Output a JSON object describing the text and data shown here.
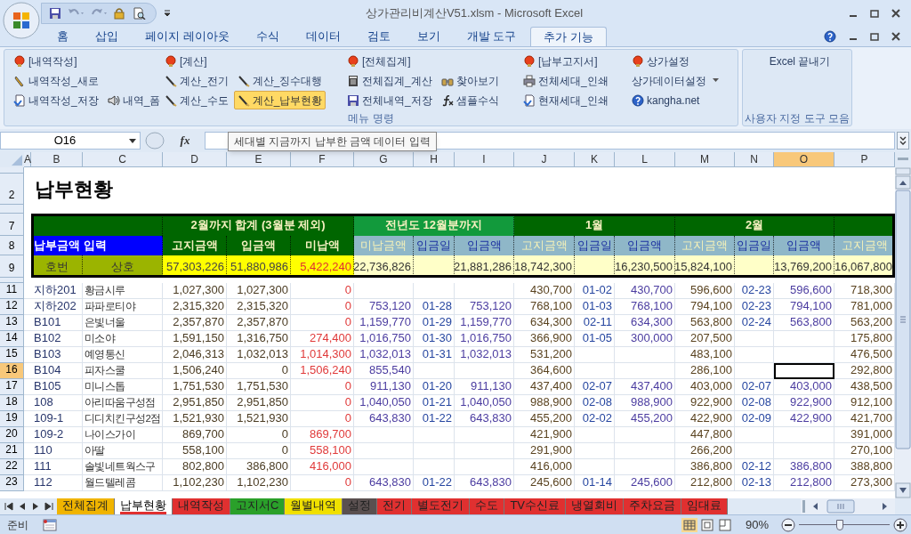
{
  "title_bar": {
    "title": "상가관리비계산V51.xlsm - Microsoft Excel"
  },
  "ribbon_tabs": [
    {
      "label": "홈",
      "selected": false
    },
    {
      "label": "삽입",
      "selected": false
    },
    {
      "label": "페이지 레이아웃",
      "selected": false
    },
    {
      "label": "수식",
      "selected": false
    },
    {
      "label": "데이터",
      "selected": false
    },
    {
      "label": "검토",
      "selected": false
    },
    {
      "label": "보기",
      "selected": false
    },
    {
      "label": "개발 도구",
      "selected": false
    },
    {
      "label": "추가 기능",
      "selected": true
    }
  ],
  "ribbon_groups": [
    {
      "label": "메뉴 명령",
      "columns": [
        [
          [
            {
              "label": "[내역작성]",
              "kind": "button",
              "selected": false
            }
          ],
          [
            {
              "label": "내역작성_새로",
              "kind": "button",
              "selected": false
            }
          ],
          [
            {
              "label": "내역작성_저장",
              "kind": "button",
              "selected": false
            },
            {
              "label": "내역_폼",
              "kind": "button",
              "selected": false
            }
          ]
        ],
        [
          [
            {
              "label": "[계산]",
              "kind": "button",
              "selected": false
            }
          ],
          [
            {
              "label": "계산_전기",
              "kind": "button",
              "selected": false
            },
            {
              "label": "계산_징수대행",
              "kind": "button",
              "selected": false
            }
          ],
          [
            {
              "label": "계산_수도",
              "kind": "button",
              "selected": false
            },
            {
              "label": "계산_납부현황",
              "kind": "button",
              "selected": true
            }
          ]
        ],
        [
          [
            {
              "label": "[전체집계]",
              "kind": "button",
              "selected": false
            }
          ],
          [
            {
              "label": "전체집계_계산",
              "kind": "button",
              "selected": false
            },
            {
              "label": "찾아보기",
              "kind": "button",
              "selected": false
            }
          ],
          [
            {
              "label": "전체내역_저장",
              "kind": "button",
              "selected": false
            },
            {
              "label": "샘플수식",
              "kind": "button",
              "selected": false
            }
          ]
        ],
        [
          [
            {
              "label": "[납부고지서]",
              "kind": "button",
              "selected": false
            }
          ],
          [
            {
              "label": "전체세대_인쇄",
              "kind": "button",
              "selected": false
            }
          ],
          [
            {
              "label": "현재세대_인쇄",
              "kind": "button",
              "selected": false
            }
          ]
        ],
        [
          [
            {
              "label": "상가설정",
              "kind": "button",
              "selected": false
            }
          ],
          [
            {
              "label": "상가데이터설정",
              "kind": "dropdown",
              "selected": false
            }
          ],
          [
            {
              "label": "kangha.net",
              "kind": "button",
              "selected": false
            }
          ]
        ]
      ]
    },
    {
      "label": "사용자 지정 도구 모음",
      "columns": [
        [
          [
            {
              "label": "Excel 끝내기",
              "kind": "button",
              "selected": false
            }
          ]
        ]
      ]
    }
  ],
  "formula_bar": {
    "name_box": "O16",
    "function_label": "fx",
    "tooltip": "세대별 지금까지 납부한 금액 데이터 입력"
  },
  "column_headers": [
    {
      "label": "A",
      "selected": false
    },
    {
      "label": "B",
      "selected": false
    },
    {
      "label": "C",
      "selected": false
    },
    {
      "label": "D",
      "selected": false
    },
    {
      "label": "E",
      "selected": false
    },
    {
      "label": "F",
      "selected": false
    },
    {
      "label": "G",
      "selected": false
    },
    {
      "label": "H",
      "selected": false
    },
    {
      "label": "I",
      "selected": false
    },
    {
      "label": "J",
      "selected": false
    },
    {
      "label": "K",
      "selected": false
    },
    {
      "label": "L",
      "selected": false
    },
    {
      "label": "M",
      "selected": false
    },
    {
      "label": "N",
      "selected": false
    },
    {
      "label": "O",
      "selected": true
    },
    {
      "label": "P",
      "selected": false
    }
  ],
  "sheet": {
    "title_row": {
      "row_label": "2",
      "text": "납부현황"
    },
    "header_rows": [
      {
        "row_label": "7",
        "cells": [
          {
            "kind": "group"
          },
          {
            "kind": "group",
            "text": "2월까지 합계 (3월분 제외)"
          },
          {
            "kind": "prior_group",
            "text": "전년도 12월분까지"
          },
          {
            "kind": "group",
            "text": "1월"
          },
          {
            "kind": "group",
            "text": "2월"
          },
          {
            "kind": "group"
          }
        ]
      },
      {
        "row_label": "8",
        "cells": [
          {
            "kind": "input_label",
            "text": "납부금액 입력"
          },
          {
            "kind": "total_head",
            "text": "고지금액"
          },
          {
            "kind": "total_head",
            "text": "입금액"
          },
          {
            "kind": "total_head",
            "text": "미납액"
          },
          {
            "kind": "bill_head",
            "text": "미납금액"
          },
          {
            "kind": "paid_head",
            "text": "입금일"
          },
          {
            "kind": "paid_head",
            "text": "입금액"
          },
          {
            "kind": "bill_head",
            "text": "고지금액"
          },
          {
            "kind": "paid_head",
            "text": "입금일"
          },
          {
            "kind": "paid_head",
            "text": "입금액"
          },
          {
            "kind": "bill_head",
            "text": "고지금액"
          },
          {
            "kind": "paid_head",
            "text": "입금일"
          },
          {
            "kind": "paid_head",
            "text": "입금액"
          },
          {
            "kind": "bill_head",
            "text": "고지금액"
          }
        ]
      },
      {
        "row_label": "9",
        "cells": [
          {
            "kind": "key_label",
            "text": "호번"
          },
          {
            "kind": "key_label",
            "text": "상호"
          },
          {
            "kind": "total",
            "text": "57,303,226"
          },
          {
            "kind": "total",
            "text": "51,880,986"
          },
          {
            "kind": "total_due",
            "text": "5,422,240"
          },
          {
            "kind": "month_total",
            "text": "22,736,826"
          },
          {
            "kind": "month_total"
          },
          {
            "kind": "month_total",
            "text": "21,881,286"
          },
          {
            "kind": "month_total",
            "text": "18,742,300"
          },
          {
            "kind": "month_total"
          },
          {
            "kind": "month_total",
            "text": "16,230,500"
          },
          {
            "kind": "month_total",
            "text": "15,824,100"
          },
          {
            "kind": "month_total"
          },
          {
            "kind": "month_total",
            "text": "13,769,200"
          },
          {
            "kind": "month_total",
            "text": "16,067,800"
          }
        ]
      }
    ],
    "data_rows": [
      {
        "row_label": "11",
        "selected": false,
        "cells": [
          "지하201",
          "황금시루",
          "1,027,300",
          "1,027,300",
          "0",
          null,
          null,
          null,
          "430,700",
          "01-02",
          "430,700",
          "596,600",
          "02-23",
          "596,600",
          "718,300"
        ]
      },
      {
        "row_label": "12",
        "selected": false,
        "cells": [
          "지하202",
          "파파로티야",
          "2,315,320",
          "2,315,320",
          "0",
          "753,120",
          "01-28",
          "753,120",
          "768,100",
          "01-03",
          "768,100",
          "794,100",
          "02-23",
          "794,100",
          "781,000"
        ]
      },
      {
        "row_label": "13",
        "selected": false,
        "cells": [
          "B101",
          "은빛너울",
          "2,357,870",
          "2,357,870",
          "0",
          "1,159,770",
          "01-29",
          "1,159,770",
          "634,300",
          "02-11",
          "634,300",
          "563,800",
          "02-24",
          "563,800",
          "563,200"
        ]
      },
      {
        "row_label": "14",
        "selected": false,
        "cells": [
          "B102",
          "미소야",
          "1,591,150",
          "1,316,750",
          "274,400",
          "1,016,750",
          "01-30",
          "1,016,750",
          "366,900",
          "01-05",
          "300,000",
          "207,500",
          null,
          null,
          "175,800"
        ]
      },
      {
        "row_label": "15",
        "selected": false,
        "cells": [
          "B103",
          "예영통신",
          "2,046,313",
          "1,032,013",
          "1,014,300",
          "1,032,013",
          "01-31",
          "1,032,013",
          "531,200",
          null,
          null,
          "483,100",
          null,
          null,
          "476,500"
        ]
      },
      {
        "row_label": "16",
        "selected": true,
        "cells": [
          "B104",
          "피자스쿨",
          "1,506,240",
          "0",
          "1,506,240",
          "855,540",
          null,
          null,
          "364,600",
          null,
          null,
          "286,100",
          null,
          null,
          "292,800"
        ]
      },
      {
        "row_label": "17",
        "selected": false,
        "cells": [
          "B105",
          "미니스톱",
          "1,751,530",
          "1,751,530",
          "0",
          "911,130",
          "01-20",
          "911,130",
          "437,400",
          "02-07",
          "437,400",
          "403,000",
          "02-07",
          "403,000",
          "438,500"
        ]
      },
      {
        "row_label": "18",
        "selected": false,
        "cells": [
          "108",
          "아리따움구성점",
          "2,951,850",
          "2,951,850",
          "0",
          "1,040,050",
          "01-21",
          "1,040,050",
          "988,900",
          "02-08",
          "988,900",
          "922,900",
          "02-08",
          "922,900",
          "912,100"
        ]
      },
      {
        "row_label": "19",
        "selected": false,
        "cells": [
          "109-1",
          "디디치킨구성2점",
          "1,521,930",
          "1,521,930",
          "0",
          "643,830",
          "01-22",
          "643,830",
          "455,200",
          "02-02",
          "455,200",
          "422,900",
          "02-09",
          "422,900",
          "421,700"
        ]
      },
      {
        "row_label": "20",
        "selected": false,
        "cells": [
          "109-2",
          "나이스가이",
          "869,700",
          "0",
          "869,700",
          null,
          null,
          null,
          "421,900",
          null,
          null,
          "447,800",
          null,
          null,
          "391,000"
        ]
      },
      {
        "row_label": "21",
        "selected": false,
        "cells": [
          "110",
          "아딸",
          "558,100",
          "0",
          "558,100",
          null,
          null,
          null,
          "291,900",
          null,
          null,
          "266,200",
          null,
          null,
          "270,100"
        ]
      },
      {
        "row_label": "22",
        "selected": false,
        "cells": [
          "111",
          "솔빛네트웍스구",
          "802,800",
          "386,800",
          "416,000",
          null,
          null,
          null,
          "416,000",
          null,
          null,
          "386,800",
          "02-12",
          "386,800",
          "388,800"
        ]
      },
      {
        "row_label": "23",
        "selected": false,
        "cells": [
          "112",
          "월드텔레콤",
          "1,102,230",
          "1,102,230",
          "0",
          "643,830",
          "01-22",
          "643,830",
          "245,600",
          "01-14",
          "245,600",
          "212,800",
          "02-13",
          "212,800",
          "273,300"
        ]
      }
    ]
  },
  "sheet_tabs": [
    {
      "label": "전체집계",
      "selected": false,
      "color": "#f0b400"
    },
    {
      "label": "납부현황",
      "selected": true,
      "color": "#e03030"
    },
    {
      "label": "내역작성",
      "selected": false,
      "color": "#e03030"
    },
    {
      "label": "고지서C",
      "selected": false,
      "color": "#2aa02a"
    },
    {
      "label": "월별내역",
      "selected": false,
      "color": "#f0e000"
    },
    {
      "label": "설정",
      "selected": false,
      "color": "#5a5050"
    },
    {
      "label": "전기",
      "selected": false,
      "color": "#e03030"
    },
    {
      "label": "별도전기",
      "selected": false,
      "color": "#e03030"
    },
    {
      "label": "수도",
      "selected": false,
      "color": "#e03030"
    },
    {
      "label": "TV수신료",
      "selected": false,
      "color": "#e03030"
    },
    {
      "label": "냉열회비",
      "selected": false,
      "color": "#e03030"
    },
    {
      "label": "주차요금",
      "selected": false,
      "color": "#e03030"
    },
    {
      "label": "임대료",
      "selected": false,
      "color": "#e03030"
    }
  ],
  "status_bar": {
    "status": "준비",
    "zoom": "90%",
    "zoom_slider": {
      "level": 0.45
    }
  }
}
